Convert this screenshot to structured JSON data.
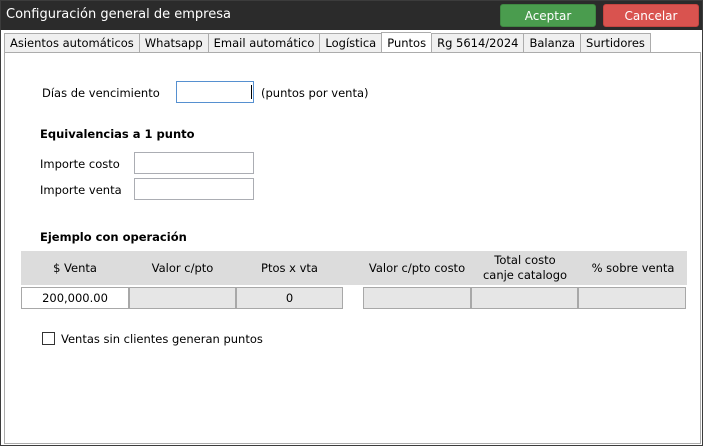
{
  "window": {
    "title": "Configuración general de empresa",
    "accept_label": "Aceptar",
    "cancel_label": "Cancelar"
  },
  "tabs": [
    {
      "label": "Asientos automáticos",
      "active": false
    },
    {
      "label": "Whatsapp",
      "active": false
    },
    {
      "label": "Email automático",
      "active": false
    },
    {
      "label": "Logística",
      "active": false
    },
    {
      "label": "Puntos",
      "active": true
    },
    {
      "label": "Rg 5614/2024",
      "active": false
    },
    {
      "label": "Balanza",
      "active": false
    },
    {
      "label": "Surtidores",
      "active": false
    }
  ],
  "puntos": {
    "dias_label": "Días de vencimiento",
    "dias_value": "",
    "dias_suffix": "(puntos por venta)",
    "equivalencias_title": "Equivalencias a 1 punto",
    "importe_costo_label": "Importe costo",
    "importe_costo_value": "",
    "importe_venta_label": "Importe venta",
    "importe_venta_value": "",
    "ejemplo_title": "Ejemplo con operación",
    "grid": {
      "headers": [
        "$ Venta",
        "Valor c/pto",
        "Ptos x vta",
        "Valor c/pto costo",
        "Total costo canje catalogo",
        "% sobre venta"
      ],
      "row": [
        "200,000.00",
        "",
        "0",
        "",
        "",
        ""
      ]
    },
    "ventas_sin_clientes_label": "Ventas sin clientes generan puntos",
    "ventas_sin_clientes_checked": false
  }
}
